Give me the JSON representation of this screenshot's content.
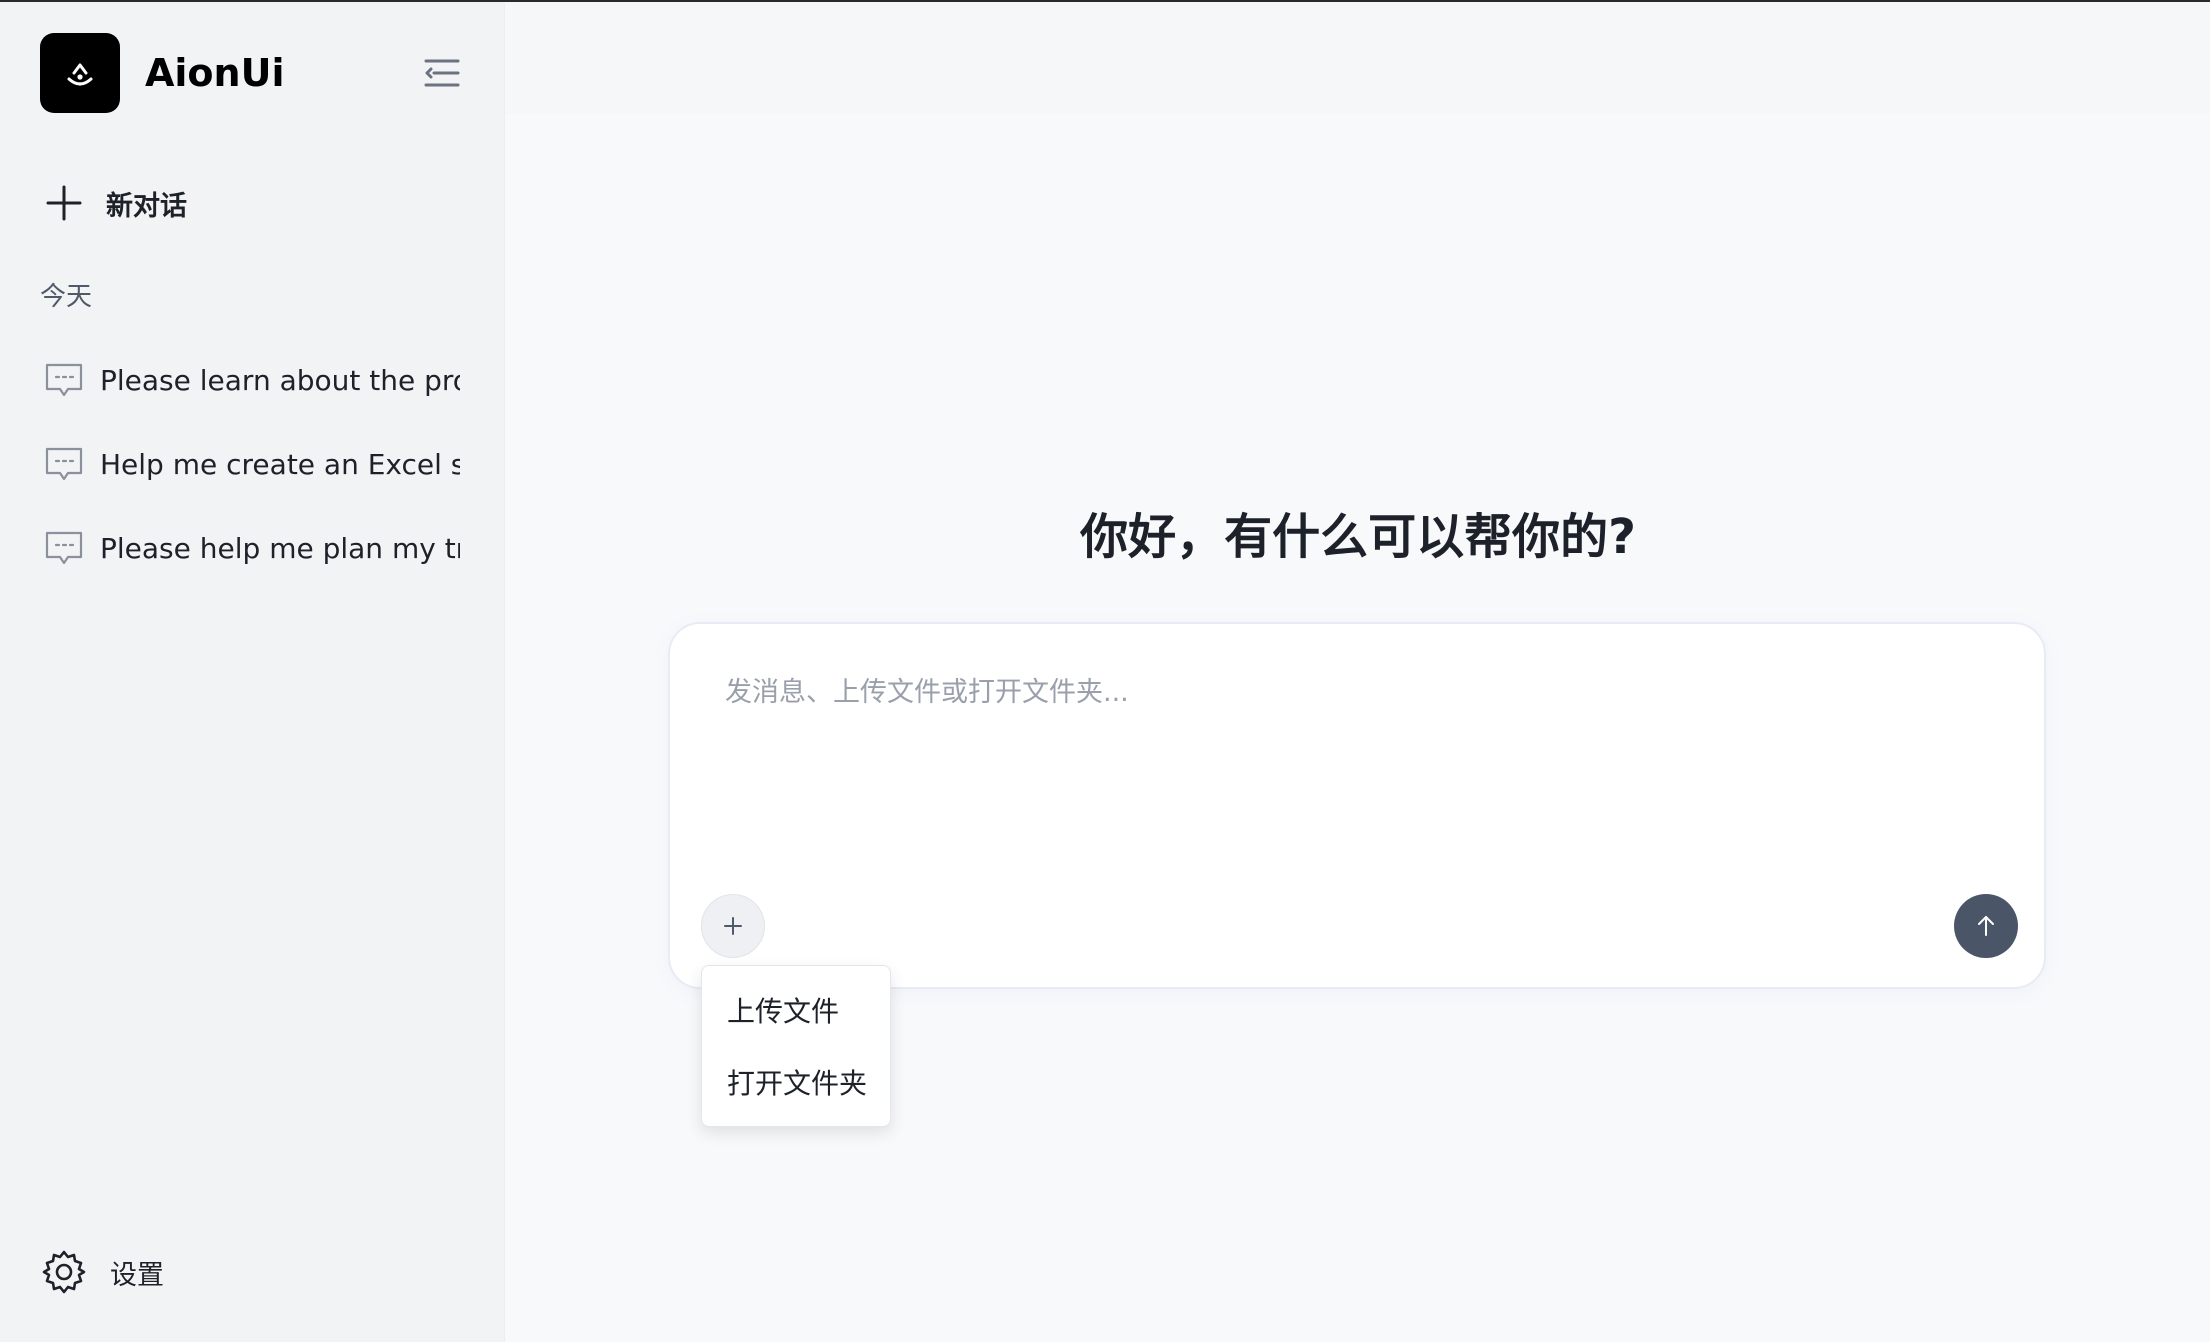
{
  "app": {
    "name": "AionUi"
  },
  "sidebar": {
    "new_chat_label": "新对话",
    "section_today": "今天",
    "history": [
      {
        "title": "Please learn about the proje"
      },
      {
        "title": "Help me create an Excel she"
      },
      {
        "title": "Please help me plan my trip:"
      }
    ],
    "settings_label": "设置"
  },
  "main": {
    "greeting": "你好，有什么可以帮你的?",
    "input_placeholder": "发消息、上传文件或打开文件夹...",
    "attach_menu": [
      {
        "label": "上传文件"
      },
      {
        "label": "打开文件夹"
      }
    ]
  },
  "icons": {
    "logo": "logo-icon",
    "collapse": "sidebar-collapse-icon",
    "new_chat": "plus-icon",
    "history": "message-icon",
    "settings": "gear-icon",
    "attach": "plus-icon",
    "send": "arrow-up-icon"
  },
  "colors": {
    "sidebar_bg": "#f2f3f5",
    "main_bg": "#f8f9fb",
    "send_button": "#4a5567",
    "logo_bg": "#000000"
  }
}
